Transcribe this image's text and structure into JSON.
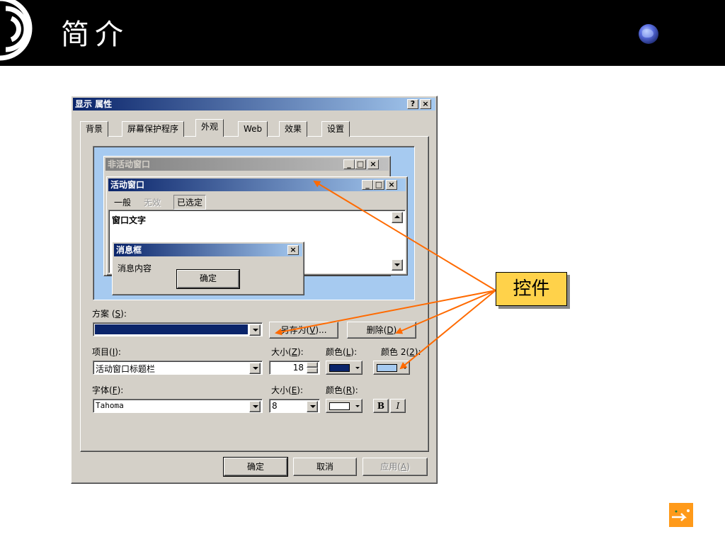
{
  "slide": {
    "title": "简介",
    "callout": "控件"
  },
  "dialog": {
    "title": "显示 属性",
    "help_button": "?",
    "close_button": "×",
    "tabs": [
      {
        "label": "背景"
      },
      {
        "label": "屏幕保护程序"
      },
      {
        "label": "外观",
        "selected": true
      },
      {
        "label": "Web"
      },
      {
        "label": "效果"
      },
      {
        "label": "设置"
      }
    ],
    "preview": {
      "inactive_window_title": "非活动窗口",
      "active_window_title": "活动窗口",
      "menu_items": [
        "一般",
        "无效",
        "已选定"
      ],
      "window_text": "窗口文字",
      "message_box_title": "消息框",
      "message_text": "消息内容",
      "message_ok": "确定"
    },
    "scheme": {
      "label": "方案",
      "accel": "S",
      "value": "",
      "save_as": "另存为",
      "save_as_accel": "V",
      "delete": "删除",
      "delete_accel": "D"
    },
    "item": {
      "label": "项目",
      "accel": "I",
      "value": "活动窗口标题栏",
      "size_label": "大小",
      "size_accel": "Z",
      "size_value": "18",
      "color_label": "颜色",
      "color_accel": "L",
      "color2_label": "颜色 2",
      "color2_accel": "2",
      "color1": "#0a246a",
      "color2": "#a6caf0"
    },
    "font": {
      "label": "字体",
      "accel": "F",
      "value": "Tahoma",
      "size_label": "大小",
      "size_accel": "E",
      "size_value": "8",
      "color_label": "颜色",
      "color_accel": "R",
      "font_color": "#ffffff",
      "bold_label": "B",
      "italic_label": "I"
    },
    "buttons": {
      "ok": "确定",
      "cancel": "取消",
      "apply": "应用",
      "apply_accel": "A"
    }
  },
  "colors": {
    "dialog_face": "#d4d0c8",
    "active_title": "#0a246a",
    "preview_desktop": "#a6caf0",
    "callout_fill": "#ffd24a",
    "arrow": "#ff6a00"
  }
}
